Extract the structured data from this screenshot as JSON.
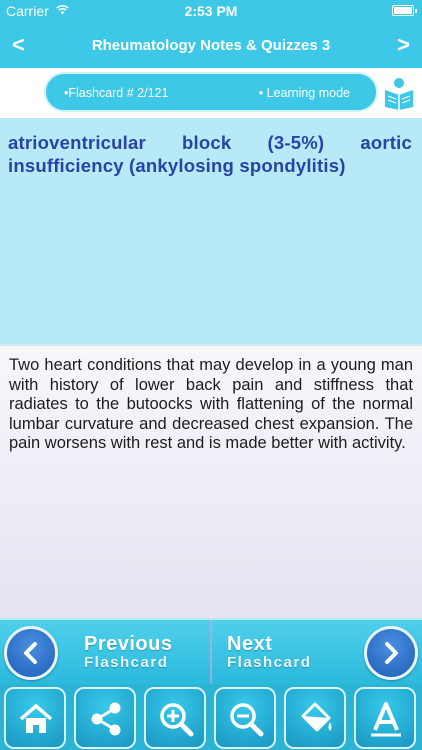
{
  "status_bar": {
    "carrier": "Carrier",
    "time": "2:53 PM"
  },
  "nav": {
    "title": "Rheumatology Notes & Quizzes 3",
    "back_icon": "chevron-left-icon",
    "forward_icon": "chevron-right-icon"
  },
  "info": {
    "flashcard": "•Flashcard #  2/121",
    "mode": "• Learning mode",
    "icon": "book-reader-icon"
  },
  "card": {
    "term": "atrioventricular block (3-5%) aortic insufficiency (ankylosing spondylitis)",
    "definition": "Two heart conditions that may develop in a young man with history of lower back pain and stiffness that radiates to the butoocks with flattening of the normal lumbar curvature and decreased chest expansion. The pain worsens with rest and is made better with activity."
  },
  "navigation": {
    "prev_big": "Previous",
    "prev_small": "Flashcard",
    "next_big": "Next",
    "next_small": "Flashcard"
  },
  "toolbar": [
    "home-icon",
    "share-icon",
    "zoom-in-icon",
    "zoom-out-icon",
    "paint-bucket-icon",
    "font-icon"
  ],
  "colors": {
    "accent": "#3cc8e6",
    "term": "#2a43a6",
    "button": "#1f5fb8"
  }
}
